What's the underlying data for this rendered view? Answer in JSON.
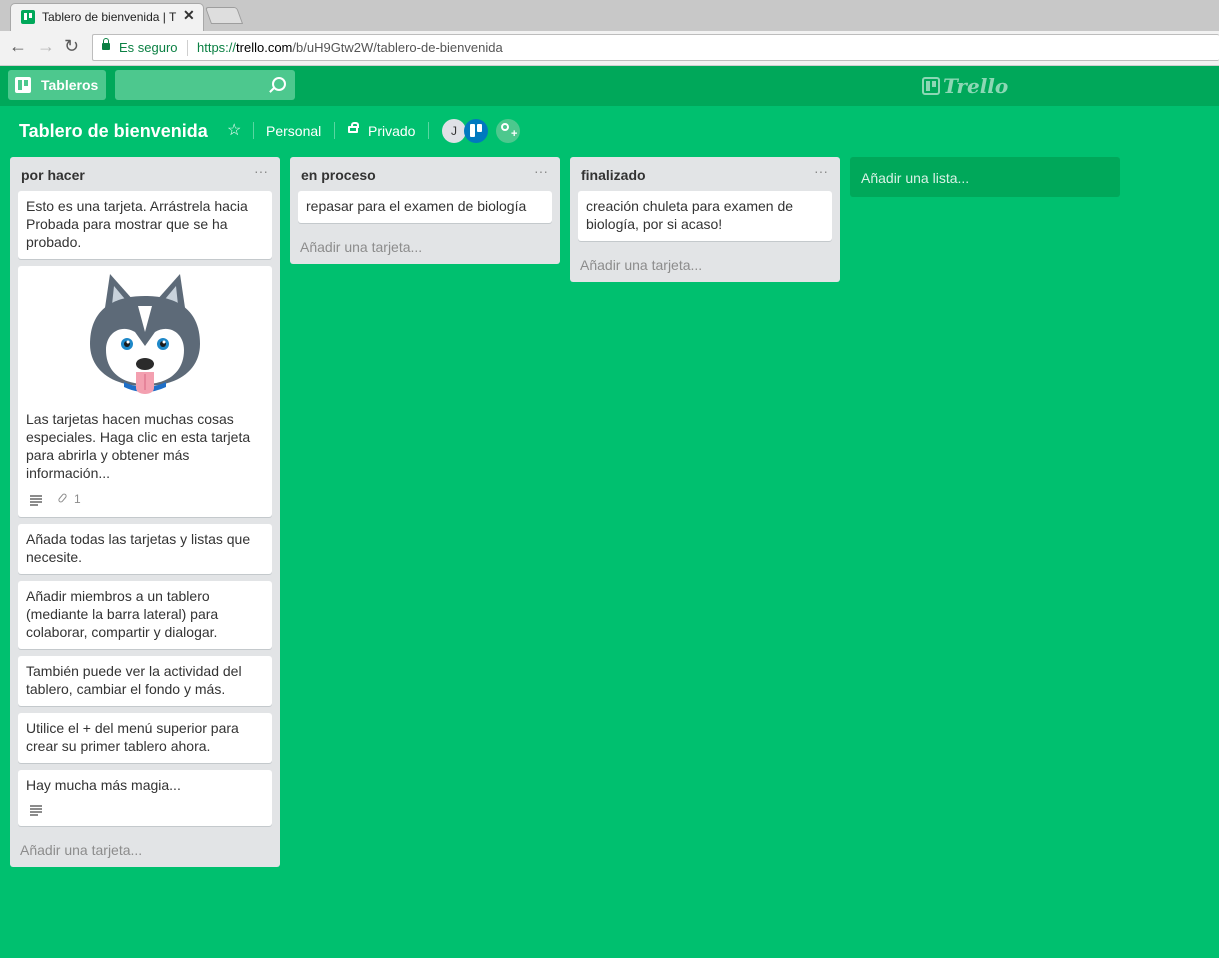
{
  "browser": {
    "tab_title": "Tablero de bienvenida | T",
    "tab_close": "✕",
    "secure_label": "Es seguro",
    "url_scheme": "https://",
    "url_host": "trello.com",
    "url_path": "/b/uH9Gtw2W/tablero-de-bienvenida"
  },
  "header": {
    "boards_label": "Tableros",
    "search_placeholder": "",
    "logo_text": "Trello",
    "brand_color": "#00a85a"
  },
  "board": {
    "title": "Tablero de bienvenida",
    "team": "Personal",
    "privacy": "Privado",
    "members": [
      {
        "initial": "J"
      },
      {
        "icon": "trello-avatar-icon"
      }
    ],
    "background_color": "#00c06f"
  },
  "lists": [
    {
      "title": "por hacer",
      "menu": "···",
      "cards": [
        {
          "text": "Esto es una tarjeta. Arrástrela hacia Probada para mostrar que se ha probado."
        },
        {
          "text": "Las tarjetas hacen muchas cosas especiales. Haga clic en esta tarjeta para abrirla y obtener más información...",
          "cover": "husky-image",
          "has_description": true,
          "attachments": "1"
        },
        {
          "text": "Añada todas las tarjetas y listas que necesite."
        },
        {
          "text": "Añadir miembros a un tablero (mediante la barra lateral) para colaborar, compartir y dialogar."
        },
        {
          "text": "También puede ver la actividad del tablero, cambiar el fondo y más."
        },
        {
          "text": "Utilice el + del menú superior para crear su primer tablero ahora."
        },
        {
          "text": "Hay mucha más magia...",
          "has_description": true
        }
      ],
      "add_card": "Añadir una tarjeta..."
    },
    {
      "title": "en proceso",
      "menu": "···",
      "cards": [
        {
          "text": "repasar para el examen de biología"
        }
      ],
      "add_card": "Añadir una tarjeta..."
    },
    {
      "title": "finalizado",
      "menu": "···",
      "cards": [
        {
          "text": "creación chuleta para examen de biología, por si acaso!"
        }
      ],
      "add_card": "Añadir una tarjeta..."
    }
  ],
  "add_list": "Añadir una lista..."
}
